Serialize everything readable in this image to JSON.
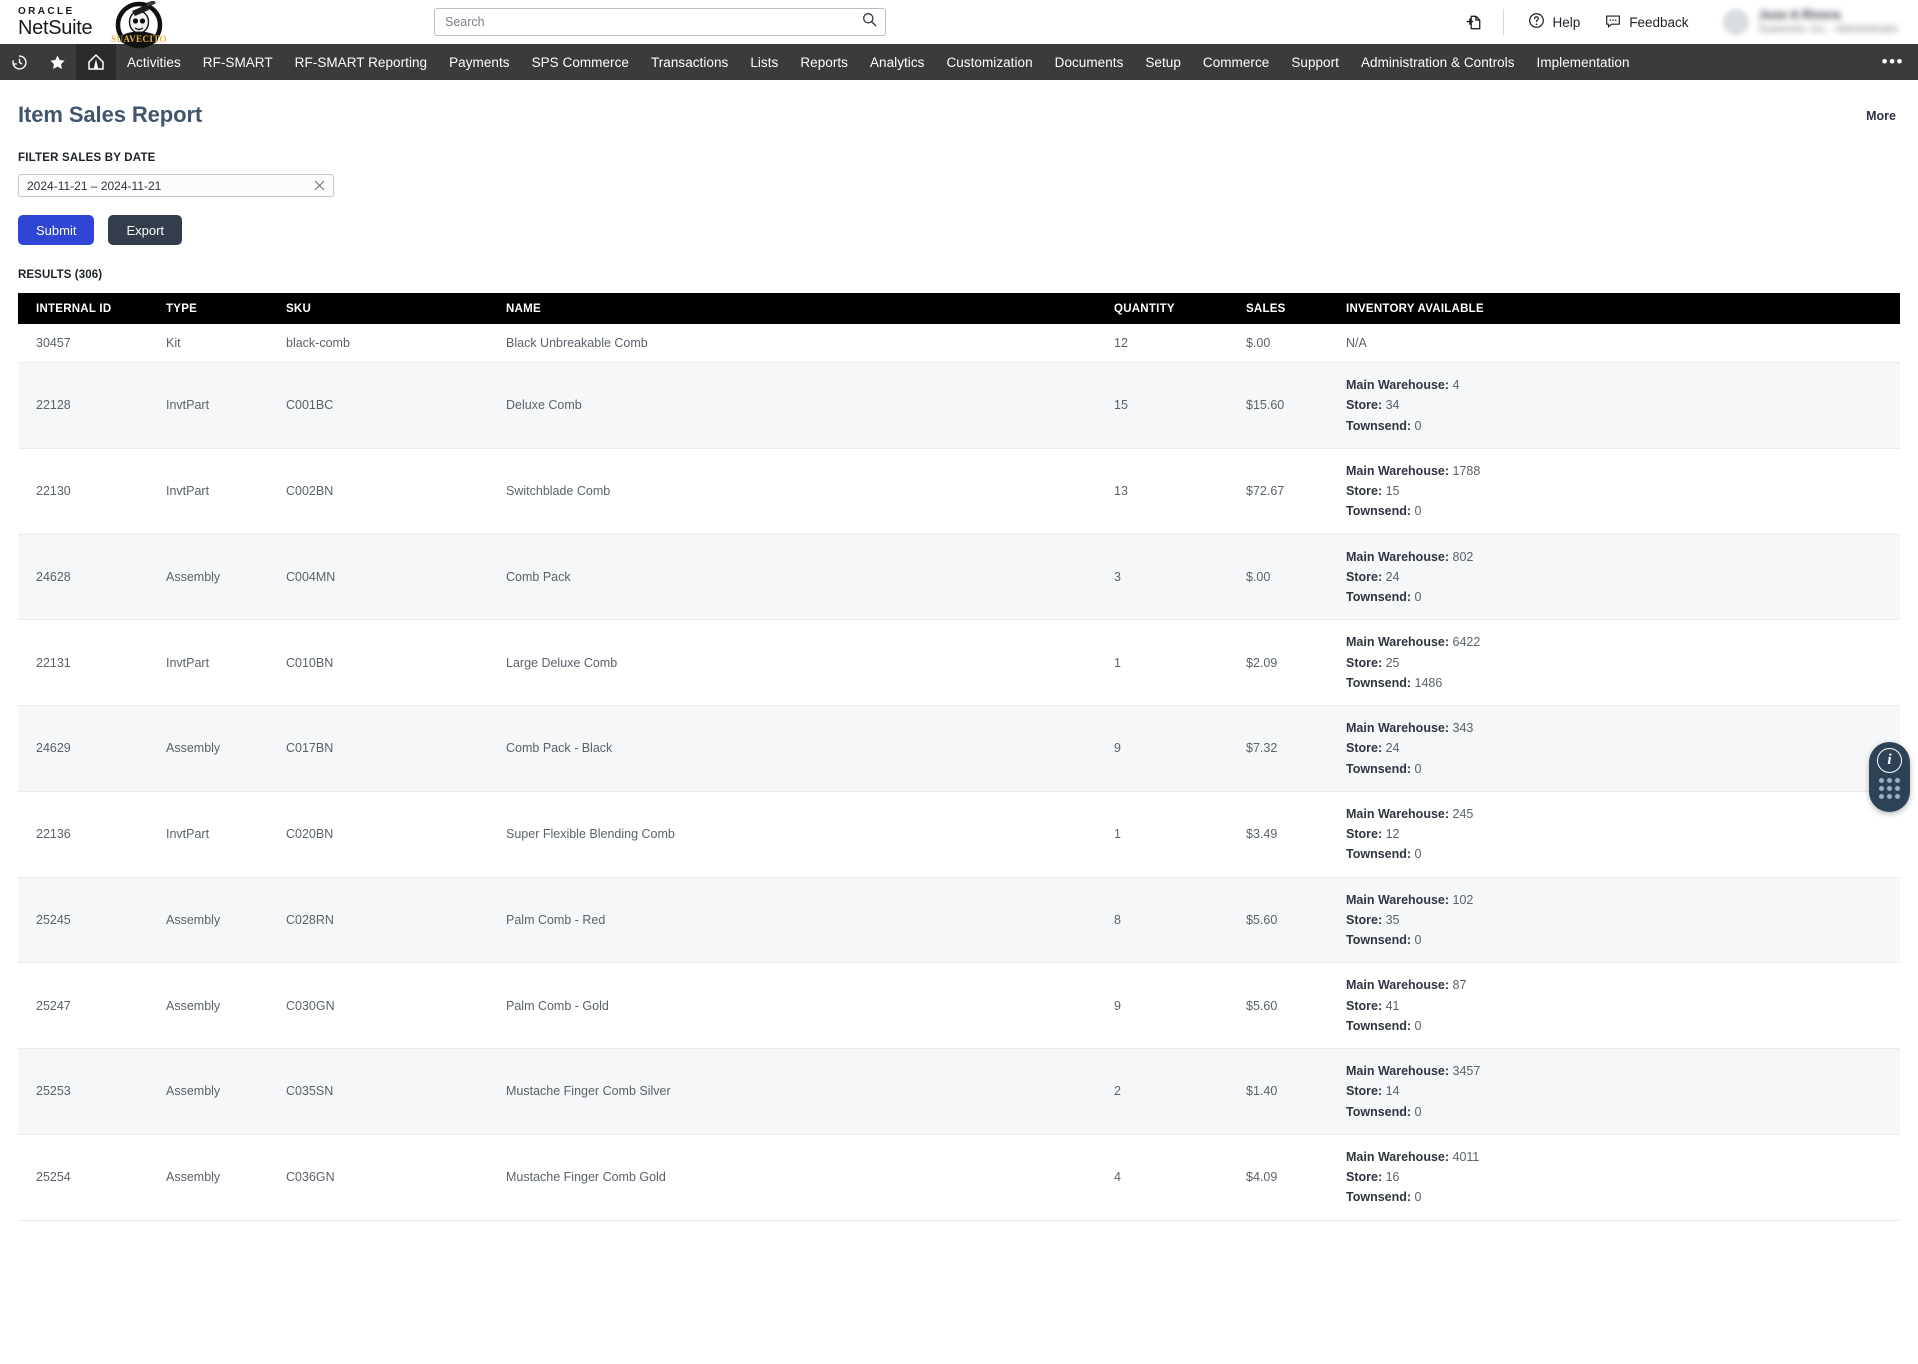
{
  "topbar": {
    "brand_oracle": "ORACLE",
    "brand_netsuite": "NetSuite",
    "company_logo_name": "suavecito-logo",
    "search_placeholder": "Search",
    "search_value": "",
    "add_icon": "add-document-icon",
    "help_label": "Help",
    "feedback_label": "Feedback",
    "user_name": "Jose A Rivera",
    "user_role": "Suavecito, Inc. - Administrator"
  },
  "nav": {
    "icons": [
      "recent-history-icon",
      "favorites-star-icon",
      "home-icon"
    ],
    "items": [
      "Activities",
      "RF-SMART",
      "RF-SMART Reporting",
      "Payments",
      "SPS Commerce",
      "Transactions",
      "Lists",
      "Reports",
      "Analytics",
      "Customization",
      "Documents",
      "Setup",
      "Commerce",
      "Support",
      "Administration & Controls",
      "Implementation"
    ],
    "more": "•••"
  },
  "page": {
    "title": "Item Sales Report",
    "more_label": "More",
    "filter_label": "FILTER SALES BY DATE",
    "date_value": "2024-11-21 – 2024-11-21",
    "clear_icon": "close-icon",
    "submit_label": "Submit",
    "export_label": "Export",
    "results_label": "RESULTS (306)"
  },
  "table": {
    "columns": [
      "INTERNAL ID",
      "TYPE",
      "SKU",
      "NAME",
      "QUANTITY",
      "SALES",
      "INVENTORY AVAILABLE"
    ],
    "rows": [
      {
        "internal_id": "30457",
        "type": "Kit",
        "sku": "black-comb",
        "name": "Black Unbreakable Comb",
        "quantity": "12",
        "sales": "$.00",
        "inventory_na": "N/A",
        "inventory": []
      },
      {
        "internal_id": "22128",
        "type": "InvtPart",
        "sku": "C001BC",
        "name": "Deluxe Comb",
        "quantity": "15",
        "sales": "$15.60",
        "inventory": [
          {
            "location": "Main Warehouse:",
            "value": "4"
          },
          {
            "location": "Store:",
            "value": "34"
          },
          {
            "location": "Townsend:",
            "value": "0"
          }
        ]
      },
      {
        "internal_id": "22130",
        "type": "InvtPart",
        "sku": "C002BN",
        "name": "Switchblade Comb",
        "quantity": "13",
        "sales": "$72.67",
        "inventory": [
          {
            "location": "Main Warehouse:",
            "value": "1788"
          },
          {
            "location": "Store:",
            "value": "15"
          },
          {
            "location": "Townsend:",
            "value": "0"
          }
        ]
      },
      {
        "internal_id": "24628",
        "type": "Assembly",
        "sku": "C004MN",
        "name": "Comb Pack",
        "quantity": "3",
        "sales": "$.00",
        "inventory": [
          {
            "location": "Main Warehouse:",
            "value": "802"
          },
          {
            "location": "Store:",
            "value": "24"
          },
          {
            "location": "Townsend:",
            "value": "0"
          }
        ]
      },
      {
        "internal_id": "22131",
        "type": "InvtPart",
        "sku": "C010BN",
        "name": "Large Deluxe Comb",
        "quantity": "1",
        "sales": "$2.09",
        "inventory": [
          {
            "location": "Main Warehouse:",
            "value": "6422"
          },
          {
            "location": "Store:",
            "value": "25"
          },
          {
            "location": "Townsend:",
            "value": "1486"
          }
        ]
      },
      {
        "internal_id": "24629",
        "type": "Assembly",
        "sku": "C017BN",
        "name": "Comb Pack - Black",
        "quantity": "9",
        "sales": "$7.32",
        "inventory": [
          {
            "location": "Main Warehouse:",
            "value": "343"
          },
          {
            "location": "Store:",
            "value": "24"
          },
          {
            "location": "Townsend:",
            "value": "0"
          }
        ]
      },
      {
        "internal_id": "22136",
        "type": "InvtPart",
        "sku": "C020BN",
        "name": "Super Flexible Blending Comb",
        "quantity": "1",
        "sales": "$3.49",
        "inventory": [
          {
            "location": "Main Warehouse:",
            "value": "245"
          },
          {
            "location": "Store:",
            "value": "12"
          },
          {
            "location": "Townsend:",
            "value": "0"
          }
        ]
      },
      {
        "internal_id": "25245",
        "type": "Assembly",
        "sku": "C028RN",
        "name": "Palm Comb - Red",
        "quantity": "8",
        "sales": "$5.60",
        "inventory": [
          {
            "location": "Main Warehouse:",
            "value": "102"
          },
          {
            "location": "Store:",
            "value": "35"
          },
          {
            "location": "Townsend:",
            "value": "0"
          }
        ]
      },
      {
        "internal_id": "25247",
        "type": "Assembly",
        "sku": "C030GN",
        "name": "Palm Comb - Gold",
        "quantity": "9",
        "sales": "$5.60",
        "inventory": [
          {
            "location": "Main Warehouse:",
            "value": "87"
          },
          {
            "location": "Store:",
            "value": "41"
          },
          {
            "location": "Townsend:",
            "value": "0"
          }
        ]
      },
      {
        "internal_id": "25253",
        "type": "Assembly",
        "sku": "C035SN",
        "name": "Mustache Finger Comb Silver",
        "quantity": "2",
        "sales": "$1.40",
        "inventory": [
          {
            "location": "Main Warehouse:",
            "value": "3457"
          },
          {
            "location": "Store:",
            "value": "14"
          },
          {
            "location": "Townsend:",
            "value": "0"
          }
        ]
      },
      {
        "internal_id": "25254",
        "type": "Assembly",
        "sku": "C036GN",
        "name": "Mustache Finger Comb Gold",
        "quantity": "4",
        "sales": "$4.09",
        "inventory": [
          {
            "location": "Main Warehouse:",
            "value": "4011"
          },
          {
            "location": "Store:",
            "value": "16"
          },
          {
            "location": "Townsend:",
            "value": "0"
          }
        ]
      }
    ]
  },
  "float_widget": {
    "info_icon": "info-icon",
    "info_glyph": "i",
    "grid_icon": "grid-dots-icon"
  },
  "colors": {
    "submit_blue": "#2f45d4",
    "export_dark": "#343d4c",
    "nav_dark": "#3b3b3b",
    "header_black": "#000000",
    "title_slate": "#42556e",
    "widget_navy": "#2e4257"
  }
}
